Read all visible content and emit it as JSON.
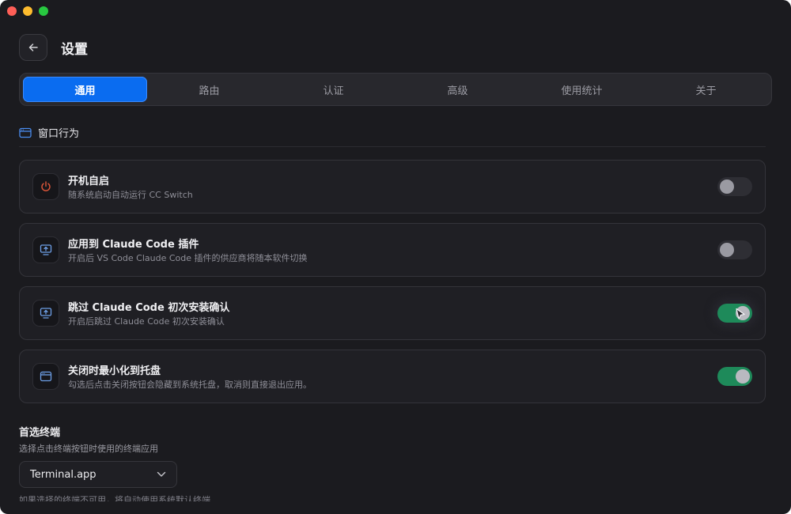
{
  "header": {
    "title": "设置",
    "back_icon": "arrow-left-icon"
  },
  "tabs": [
    {
      "label": "通用",
      "active": true
    },
    {
      "label": "路由",
      "active": false
    },
    {
      "label": "认证",
      "active": false
    },
    {
      "label": "高级",
      "active": false
    },
    {
      "label": "使用统计",
      "active": false
    },
    {
      "label": "关于",
      "active": false
    }
  ],
  "section": {
    "label": "窗口行为",
    "icon": "app-window-icon"
  },
  "settings": [
    {
      "title": "开机自启",
      "desc": "随系统启动自动运行 CC Switch",
      "icon": "power-icon",
      "enabled": false
    },
    {
      "title": "应用到 Claude Code 插件",
      "desc": "开启后 VS Code Claude Code 插件的供应商将随本软件切换",
      "icon": "monitor-upload-icon",
      "enabled": false
    },
    {
      "title": "跳过 Claude Code 初次安装确认",
      "desc": "开启后跳过 Claude Code 初次安装确认",
      "icon": "monitor-upload-icon",
      "enabled": true
    },
    {
      "title": "关闭时最小化到托盘",
      "desc": "勾选后点击关闭按钮会隐藏到系统托盘，取消则直接退出应用。",
      "icon": "app-window-icon",
      "enabled": true
    }
  ],
  "terminal": {
    "title": "首选终端",
    "desc": "选择点击终端按钮时使用的终端应用",
    "selected": "Terminal.app",
    "note": "如果选择的终端不可用，将自动使用系统默认终端"
  },
  "colors": {
    "accent": "#0a6cf0",
    "toggle_on": "#1e8a5a",
    "background": "#1b1b1f"
  }
}
